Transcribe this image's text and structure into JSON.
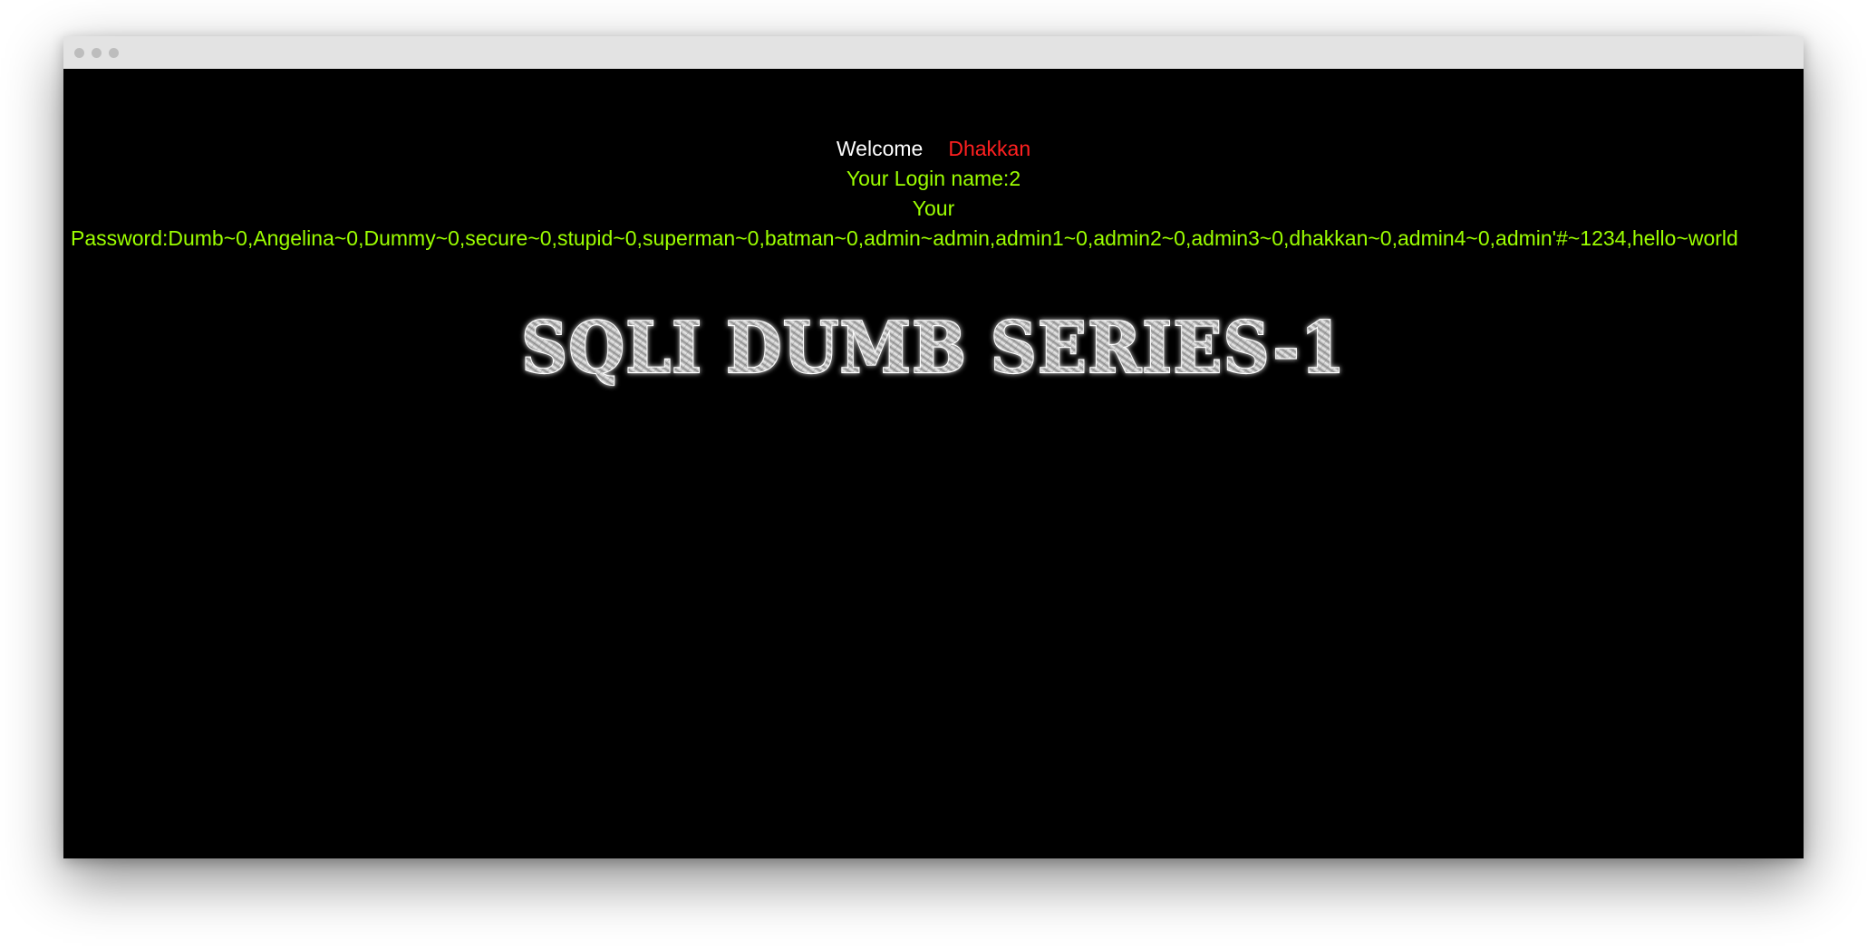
{
  "window": {
    "controls": [
      "close",
      "minimize",
      "maximize"
    ]
  },
  "page": {
    "welcome_text": "Welcome",
    "user_name": "Dhakkan",
    "login_line": "Your Login name:2",
    "password_prefix": "Your",
    "password_line": "Password:Dumb~0,Angelina~0,Dummy~0,secure~0,stupid~0,superman~0,batman~0,admin~admin,admin1~0,admin2~0,admin3~0,dhakkan~0,admin4~0,admin'#~1234,hello~world",
    "banner_title": "SQLI DUMB SERIES-1"
  },
  "colors": {
    "background": "#000000",
    "welcome": "#ffffff",
    "user_name": "#ff2020",
    "green_text": "#9cff00"
  }
}
